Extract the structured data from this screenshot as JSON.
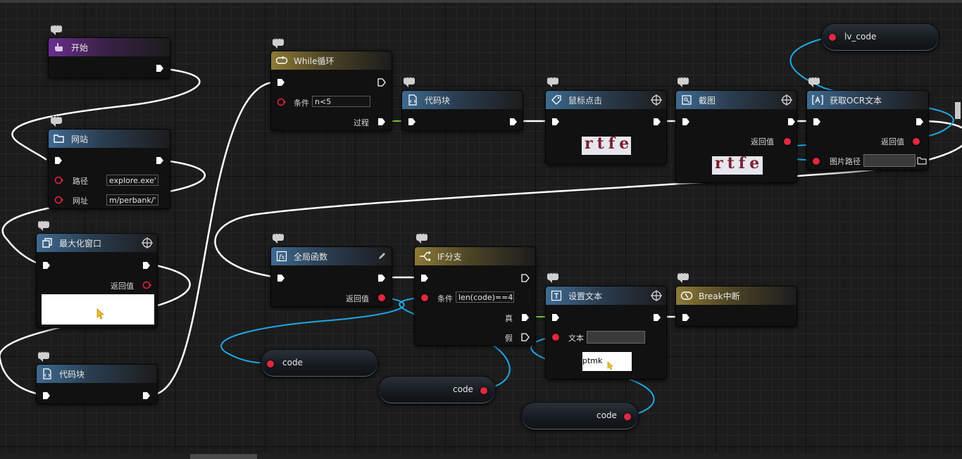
{
  "nodes": {
    "start": {
      "title": "开始"
    },
    "website": {
      "title": "网站",
      "path_label": "路径",
      "path_value": "explore.exe'",
      "url_label": "网址",
      "url_value": "m/perbank/'"
    },
    "maximize": {
      "title": "最大化窗口",
      "return_label": "返回值"
    },
    "codeblock_left": {
      "title": "代码块"
    },
    "while_loop": {
      "title": "While循环",
      "cond_label": "条件",
      "cond_value": "n<5",
      "process_label": "过程"
    },
    "codeblock_mid": {
      "title": "代码块"
    },
    "mouse_click": {
      "title": "鼠标点击",
      "captcha_text": "rtfe"
    },
    "screenshot": {
      "title": "截图",
      "return_label": "返回值",
      "captcha_text": "rtfe"
    },
    "ocr": {
      "title": "获取OCR文本",
      "return_label": "返回值",
      "path_label": "图片路径",
      "path_value": ""
    },
    "global_func": {
      "title": "全局函数",
      "return_label": "返回值"
    },
    "if_branch": {
      "title": "IF分支",
      "cond_label": "条件",
      "cond_value": "len(code)==4",
      "true_label": "真",
      "false_label": "假"
    },
    "set_text": {
      "title": "设置文本",
      "text_label": "文本",
      "text_value": "",
      "preview_text": "ptmk"
    },
    "break_node": {
      "title": "Break中断"
    }
  },
  "variables": {
    "lv_code": "lv_code",
    "code_a": "code",
    "code_b": "code",
    "code_c": "code"
  },
  "colors": {
    "exec_wire": "#ffffff",
    "data_wire": "#1fa8e6",
    "green_wire": "#6bcf3a",
    "data_pin": "#e0283e",
    "header_blue": "#3e6a90",
    "header_gold": "#8d7a36",
    "header_purple": "#6b2d8f"
  }
}
